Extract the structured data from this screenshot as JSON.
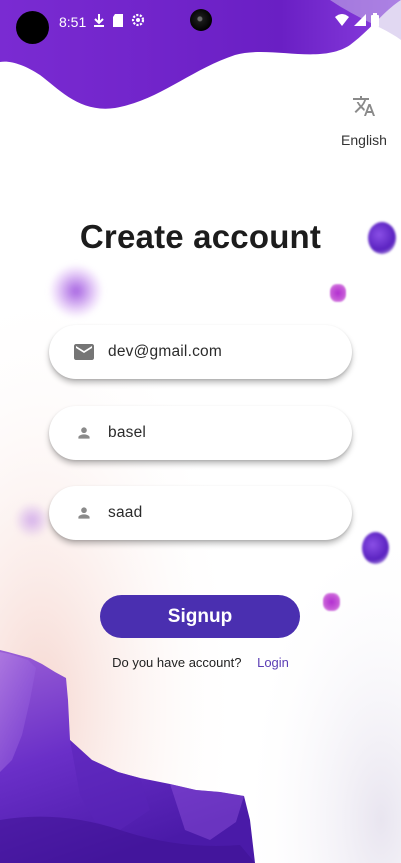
{
  "status_bar": {
    "time": "8:51",
    "left_icons": [
      "download-icon",
      "sd-card-icon",
      "settings-icon"
    ],
    "right_icons": [
      "wifi-icon",
      "signal-icon",
      "battery-icon"
    ]
  },
  "language": {
    "icon": "translate-icon",
    "label": "English"
  },
  "title": "Create account",
  "form": {
    "email": {
      "icon": "email-icon",
      "value": "dev@gmail.com"
    },
    "first_name": {
      "icon": "person-icon",
      "value": "basel"
    },
    "last_name": {
      "icon": "person-icon",
      "value": "saad"
    }
  },
  "signup_button": {
    "label": "Signup"
  },
  "login_prompt": {
    "question": "Do you have account?",
    "link": "Login"
  },
  "colors": {
    "primary": "#4a2fb0",
    "accent_purple": "#7b2fd6",
    "link": "#5b3db5"
  }
}
